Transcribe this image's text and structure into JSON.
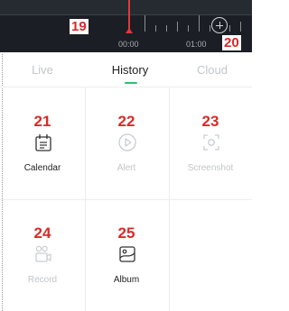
{
  "timeline": {
    "time_labels": [
      "00:00",
      "01:00"
    ],
    "annotations": {
      "playhead": "19",
      "zoom": "20"
    }
  },
  "tabs": {
    "live": "Live",
    "history": "History",
    "cloud": "Cloud",
    "active": "history"
  },
  "features": [
    {
      "number": "21",
      "label": "Calendar",
      "icon": "calendar-icon",
      "enabled": true
    },
    {
      "number": "22",
      "label": "Alert",
      "icon": "alert-play-icon",
      "enabled": false
    },
    {
      "number": "23",
      "label": "Screenshot",
      "icon": "screenshot-icon",
      "enabled": false
    },
    {
      "number": "24",
      "label": "Record",
      "icon": "record-icon",
      "enabled": false
    },
    {
      "number": "25",
      "label": "Album",
      "icon": "album-icon",
      "enabled": true
    }
  ],
  "colors": {
    "accent": "#2fbf71",
    "annotation": "#d92a2a",
    "playhead": "#e03a3a",
    "timeline_bg": "#1b1e24"
  }
}
